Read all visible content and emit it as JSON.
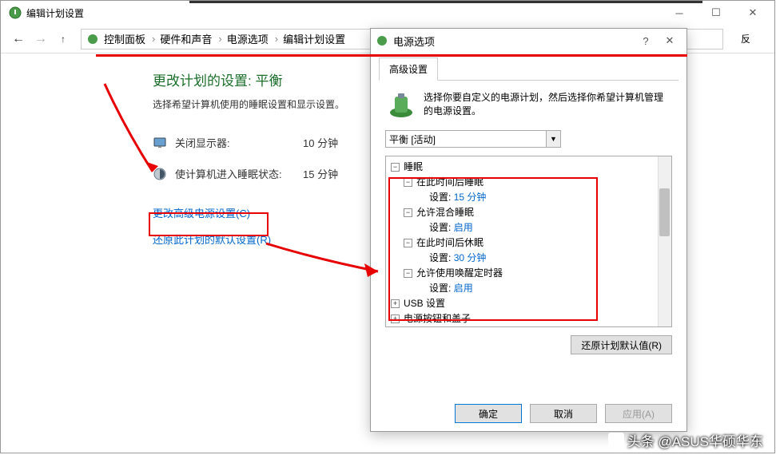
{
  "mainWindow": {
    "title": "编辑计划设置",
    "breadcrumb": [
      "控制面板",
      "硬件和声音",
      "电源选项",
      "编辑计划设置"
    ]
  },
  "content": {
    "heading": "更改计划的设置: 平衡",
    "subtext": "选择希望计算机使用的睡眠设置和显示设置。",
    "rows": [
      {
        "label": "关闭显示器:",
        "value": "10 分钟"
      },
      {
        "label": "使计算机进入睡眠状态:",
        "value": "15 分钟"
      }
    ],
    "link1": "更改高级电源设置(C)",
    "link2": "还原此计划的默认设置(R)"
  },
  "dialog": {
    "title": "电源选项",
    "tab": "高级设置",
    "description": "选择你要自定义的电源计划，然后选择你希望计算机管理的电源设置。",
    "plan": "平衡 [活动]",
    "tree": {
      "sleep": {
        "label": "睡眠",
        "afterSleep": {
          "label": "在此时间后睡眠",
          "set": "设置:",
          "val": "15 分钟"
        },
        "hybrid": {
          "label": "允许混合睡眠",
          "set": "设置:",
          "val": "启用"
        },
        "afterHibernate": {
          "label": "在此时间后休眠",
          "set": "设置:",
          "val": "30 分钟"
        },
        "wakeTimers": {
          "label": "允许使用唤醒定时器",
          "set": "设置:",
          "val": "启用"
        }
      },
      "usb": "USB 设置",
      "power": "电源按钮和盖子"
    },
    "restoreBtn": "还原计划默认值(R)",
    "ok": "确定",
    "cancel": "取消",
    "apply": "应用(A)"
  },
  "watermark": "头条 @ASUS华硕华东"
}
